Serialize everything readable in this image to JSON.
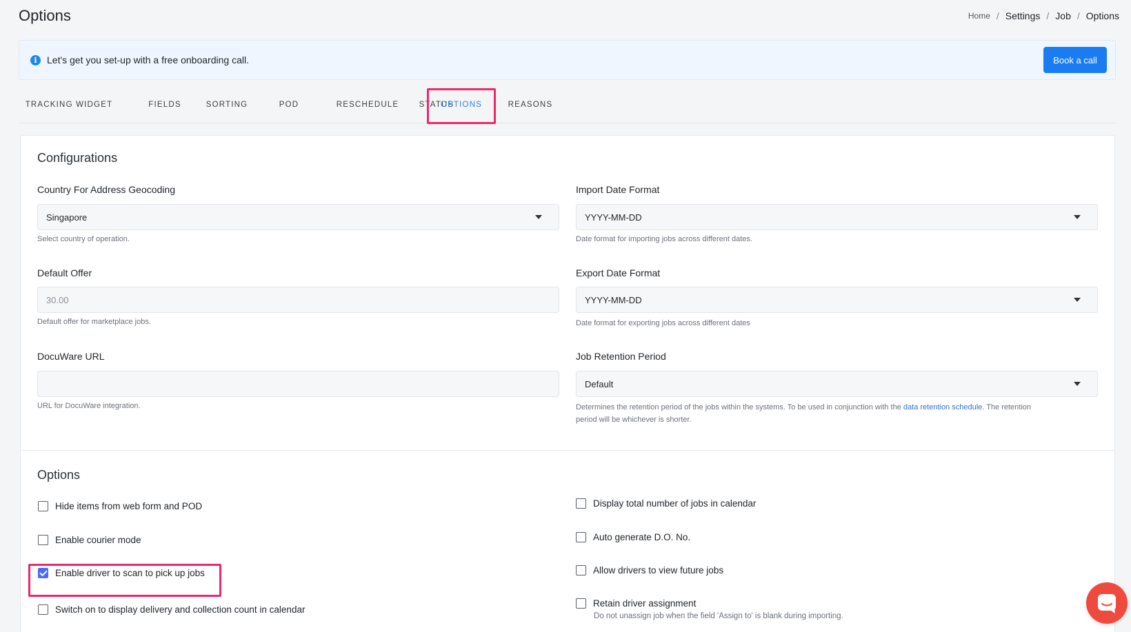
{
  "header": {
    "title": "Options",
    "breadcrumb": [
      "Home",
      "Settings",
      "Job",
      "Options"
    ]
  },
  "banner": {
    "icon": "info-icon",
    "text": "Let's get you set-up with a free onboarding call.",
    "button_label": "Book a call"
  },
  "tabs": [
    {
      "label": "TRACKING WIDGET"
    },
    {
      "label": "FIELDS"
    },
    {
      "label": "SORTING"
    },
    {
      "label": "POD"
    },
    {
      "label": "RESCHEDULE"
    },
    {
      "label": "STATUS"
    },
    {
      "label": "OPTIONS",
      "active": true
    },
    {
      "label": "REASONS"
    }
  ],
  "configurations": {
    "title": "Configurations",
    "country": {
      "label": "Country For Address Geocoding",
      "value": "Singapore",
      "help": "Select country of operation."
    },
    "import_date": {
      "label": "Import Date Format",
      "value": "YYYY-MM-DD",
      "help": "Date format for importing jobs across different dates."
    },
    "default_offer": {
      "label": "Default Offer",
      "placeholder": "30.00",
      "help": "Default offer for marketplace jobs."
    },
    "export_date": {
      "label": "Export Date Format",
      "value": "YYYY-MM-DD",
      "help": "Date format for exporting jobs across different dates"
    },
    "docuware": {
      "label": "DocuWare URL",
      "value": "",
      "help": "URL for DocuWare integration."
    },
    "retention": {
      "label": "Job Retention Period",
      "value": "Default",
      "help_before": "Determines the retention period of the jobs within the systems. To be used in conjunction with the ",
      "help_link": "data retention schedule",
      "help_after": ". The retention",
      "help_line2": "period will be whichever is shorter."
    }
  },
  "options": {
    "title": "Options",
    "left": [
      {
        "label": "Hide items from web form and POD",
        "checked": false
      },
      {
        "label": "Enable courier mode",
        "checked": false
      },
      {
        "label": "Enable driver to scan to pick up jobs",
        "checked": true
      },
      {
        "label": "Switch on to display delivery and collection count in calendar",
        "checked": false
      }
    ],
    "right": [
      {
        "label": "Display total number of jobs in calendar",
        "checked": false
      },
      {
        "label": "Auto generate D.O. No.",
        "checked": false
      },
      {
        "label": "Allow drivers to view future jobs",
        "checked": false
      },
      {
        "label": "Retain driver assignment",
        "checked": false,
        "sub": "Do not unassign job when the field 'Assign to' is blank during importing."
      }
    ]
  },
  "colors": {
    "accent": "#2f80ed",
    "button": "#1a7cf2",
    "highlight": "#f0266b",
    "chat": "#ee4a3d"
  }
}
